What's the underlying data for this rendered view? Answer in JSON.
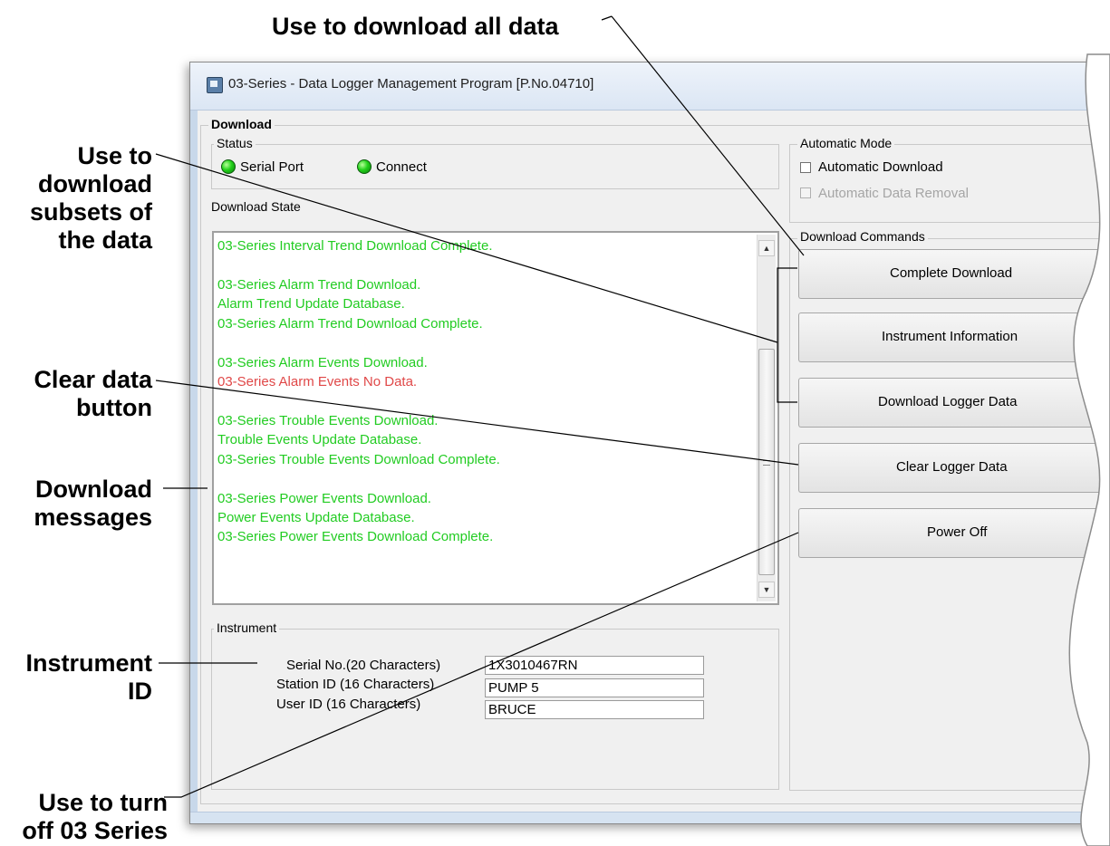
{
  "annotations": {
    "download_all": "Use to download all data",
    "subsets": "Use to\ndownload\nsubsets of\nthe data",
    "clear": "Clear data\nbutton",
    "messages": "Download\nmessages",
    "instrument_id": "Instrument\nID",
    "turn_off": "Use to turn\noff 03 Series"
  },
  "window": {
    "title": "03-Series  - Data Logger Management Program [P.No.04710]",
    "icon": "app-icon"
  },
  "download": {
    "group_label": "Download",
    "status": {
      "label": "Status",
      "indicators": [
        {
          "label": "Serial Port",
          "color": "#22d11a"
        },
        {
          "label": "Connect",
          "color": "#22d11a"
        }
      ]
    },
    "state_label": "Download State",
    "messages": [
      {
        "text": "03-Series Interval Trend Download Complete.",
        "error": false
      },
      {
        "text": "03-Series Alarm Trend Download.",
        "error": false
      },
      {
        "text": "Alarm Trend Update Database.",
        "error": false
      },
      {
        "text": "03-Series Alarm Trend Download Complete.",
        "error": false
      },
      {
        "text": "03-Series Alarm Events Download.",
        "error": false
      },
      {
        "text": "03-Series Alarm Events No Data.",
        "error": true
      },
      {
        "text": "03-Series Trouble Events Download.",
        "error": false
      },
      {
        "text": "Trouble Events Update Database.",
        "error": false
      },
      {
        "text": "03-Series Trouble Events Download Complete.",
        "error": false
      },
      {
        "text": "03-Series Power Events Download.",
        "error": false
      },
      {
        "text": "Power Events Update Database.",
        "error": false
      },
      {
        "text": "03-Series Power Events Download Complete.",
        "error": false
      }
    ]
  },
  "instrument": {
    "label": "Instrument",
    "fields": [
      {
        "label": "Serial No.(20 Characters)",
        "value": "1X3010467RN"
      },
      {
        "label": "Station ID (16 Characters)",
        "value": "PUMP 5"
      },
      {
        "label": "User ID (16 Characters)",
        "value": "BRUCE"
      }
    ]
  },
  "automatic_mode": {
    "label": "Automatic Mode",
    "auto_download": {
      "label": "Automatic Download",
      "checked": false,
      "enabled": true
    },
    "auto_removal": {
      "label": "Automatic Data Removal",
      "checked": false,
      "enabled": false
    }
  },
  "commands": {
    "label": "Download Commands",
    "buttons": {
      "complete": "Complete Download",
      "info": "Instrument Information",
      "logger": "Download Logger Data",
      "clear": "Clear Logger Data",
      "power": "Power Off"
    }
  },
  "colors": {
    "message_ok": "#22cc22",
    "message_error": "#e04848",
    "led": "#22d11a"
  }
}
